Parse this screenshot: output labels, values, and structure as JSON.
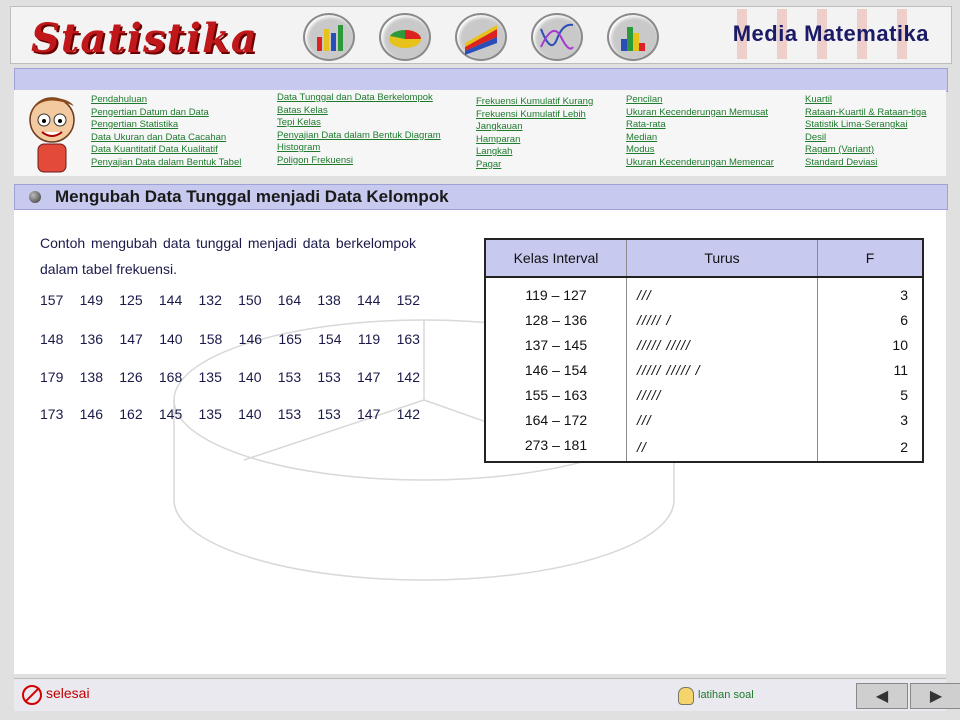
{
  "header": {
    "logo": "Statistika",
    "brand": "Media Matematika",
    "icons": [
      "bar-chart-icon",
      "pie-chart-icon",
      "area-chart-icon",
      "line-chart-icon",
      "histogram-icon"
    ]
  },
  "menu": {
    "col1": [
      "Pendahuluan",
      "Pengertian Datum dan Data",
      "Pengertian Statistika",
      "Data Ukuran dan Data Cacahan",
      "Data Kuantitatif Data Kualitatif",
      "Penyajian Data dalam Bentuk Tabel"
    ],
    "col2": [
      "Data Tunggal dan Data Berkelompok",
      "Batas Kelas",
      "Tepi Kelas",
      "Penyajian Data dalam Bentuk Diagram",
      "Histogram",
      "Poligon Frekuensi"
    ],
    "col3": [
      "Frekuensi Kumulatif Kurang",
      "Frekuensi Kumulatif Lebih",
      "Jangkauan",
      "Hamparan",
      "Langkah",
      "Pagar"
    ],
    "col4": [
      "Pencilan",
      "Ukuran Kecenderungan Memusat",
      "Rata-rata",
      "Median",
      "Modus",
      "Ukuran Kecenderungan Memencar"
    ],
    "col5": [
      "Kuartil",
      "Rataan-Kuartil & Rataan-tiga",
      "Statistik Lima-Serangkai",
      "Desil",
      "Ragam (Variant)",
      "Standard Deviasi"
    ]
  },
  "section_title": "Mengubah Data Tunggal menjadi Data Kelompok",
  "description": "Contoh mengubah data tunggal menjadi data berkelompok dalam tabel frekuensi.",
  "data_rows": [
    [
      "157",
      "149",
      "125",
      "144",
      "132",
      "150",
      "164",
      "138",
      "144",
      "152"
    ],
    [
      "148",
      "136",
      "147",
      "140",
      "158",
      "146",
      "165",
      "154",
      "119",
      "163"
    ],
    [
      "179",
      "138",
      "126",
      "168",
      "135",
      "140",
      "153",
      "153",
      "147",
      "142"
    ],
    [
      "173",
      "146",
      "162",
      "145",
      "135",
      "140",
      "153",
      "153",
      "147",
      "142"
    ]
  ],
  "table": {
    "headers": [
      "Kelas Interval",
      "Turus",
      "F"
    ],
    "rows": [
      {
        "interval": "119 – 127",
        "turus": "///",
        "f": "3"
      },
      {
        "interval": "128 – 136",
        "turus": "/////   /",
        "f": "6"
      },
      {
        "interval": "137 – 145",
        "turus": "/////   /////",
        "f": "10"
      },
      {
        "interval": "146 – 154",
        "turus": "/////   /////   /",
        "f": "11"
      },
      {
        "interval": "155 – 163",
        "turus": "/////",
        "f": "5"
      },
      {
        "interval": "164 – 172",
        "turus": "///",
        "f": "3"
      },
      {
        "interval": "273 – 181",
        "turus": "//",
        "f": "2"
      }
    ]
  },
  "footer": {
    "exit_label": "selesai",
    "exercise_label": "latihan soal",
    "prev_symbol": "◀",
    "next_symbol": "▶"
  }
}
